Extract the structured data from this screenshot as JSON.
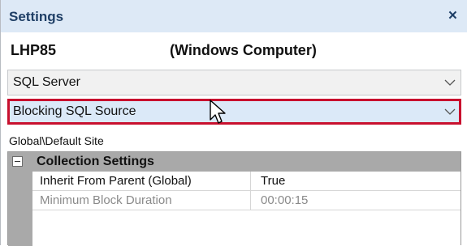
{
  "panel": {
    "title": "Settings",
    "close_glyph": "×"
  },
  "host": {
    "name": "LHP85",
    "type": "(Windows Computer)"
  },
  "selectors": [
    {
      "value": "SQL Server",
      "icon": "chevron-down-icon",
      "selected": false
    },
    {
      "value": "Blocking SQL Source",
      "icon": "chevron-down-icon",
      "selected": true
    }
  ],
  "path": "Global\\Default Site",
  "grid": {
    "category": "Collection Settings",
    "rows": [
      {
        "name": "Inherit From Parent (Global)",
        "value": "True",
        "enabled": true
      },
      {
        "name": "Minimum Block Duration",
        "value": "00:00:15",
        "enabled": false
      }
    ]
  },
  "colors": {
    "highlight_border": "#c8102e",
    "title_bar": "#dde9f6",
    "category_bar": "#a9a9a9"
  }
}
